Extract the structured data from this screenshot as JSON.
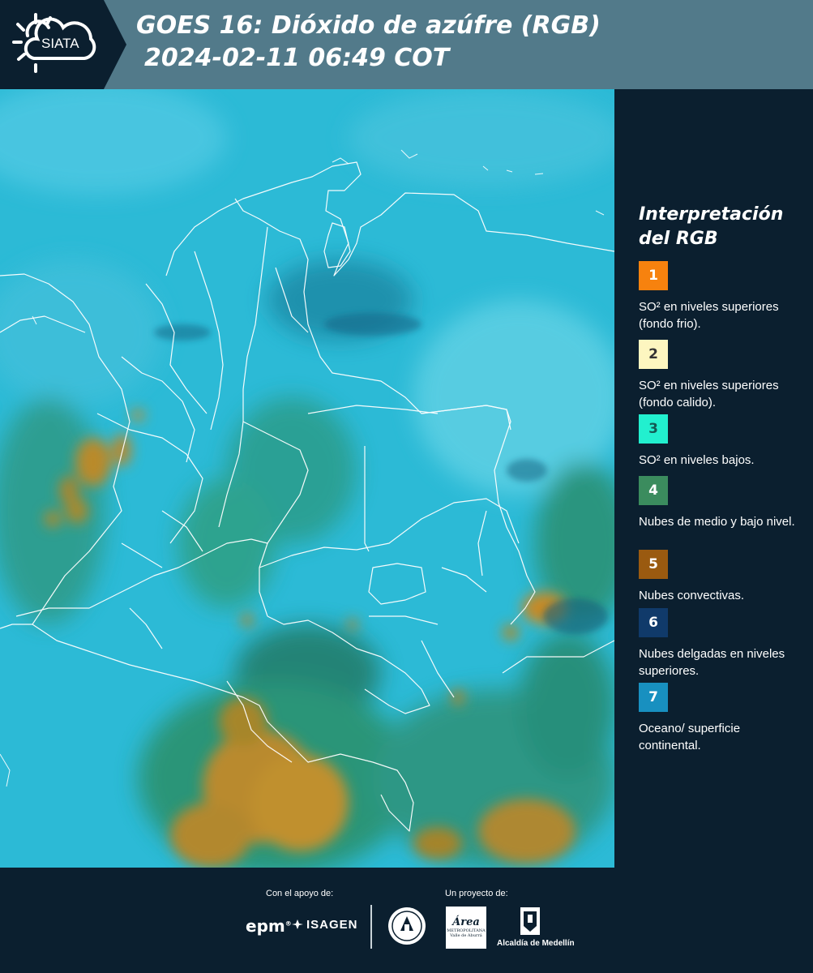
{
  "header": {
    "logo_text": "SIATA",
    "title": "GOES 16: Dióxido de azúfre (RGB)",
    "subtitle": "2024-02-11 06:49 COT"
  },
  "legend": {
    "title": "Interpretación del RGB",
    "items": [
      {
        "number": "1",
        "color": "#f7820e",
        "text_color": "#ffffff",
        "label": "SO² en niveles superiores (fondo frio)."
      },
      {
        "number": "2",
        "color": "#fdf6c0",
        "text_color": "#333333",
        "label": "SO² en niveles superiores (fondo calido)."
      },
      {
        "number": "3",
        "color": "#22f0cf",
        "text_color": "#145a54",
        "label": "SO² en niveles bajos."
      },
      {
        "number": "4",
        "color": "#3b8c5e",
        "text_color": "#ffffff",
        "label": "Nubes de medio y bajo nivel."
      },
      {
        "number": "5",
        "color": "#9a5a10",
        "text_color": "#ffffff",
        "label": "Nubes convectivas."
      },
      {
        "number": "6",
        "color": "#103a6a",
        "text_color": "#ffffff",
        "label": "Nubes delgadas en niveles superiores."
      },
      {
        "number": "7",
        "color": "#1890c0",
        "text_color": "#ffffff",
        "label": "Oceano/ superficie continental."
      }
    ]
  },
  "footer": {
    "support_label": "Con el apoyo de:",
    "project_label": "Un proyecto de:",
    "sponsor_1": "epm",
    "sponsor_1_mark": "®",
    "sponsor_2": "ISAGEN",
    "partner_1_name": "Área",
    "partner_1_sub": "METROPOLITANA Valle de Aburrá",
    "partner_2": "Alcaldía de Medellín"
  }
}
